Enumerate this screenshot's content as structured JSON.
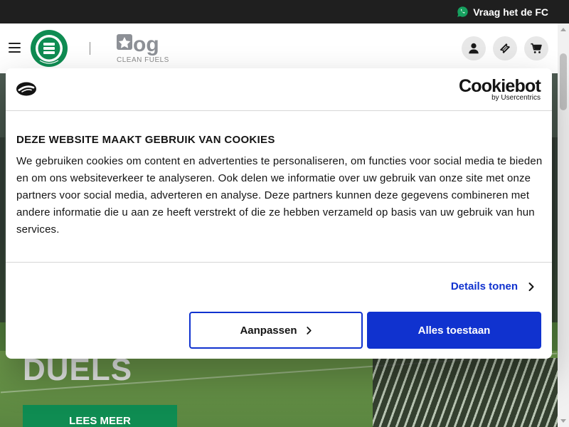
{
  "topbar": {
    "ask_label": "Vraag het de FC",
    "ask_icon": "chat-bubble-icon",
    "accent": "#0f8c52"
  },
  "header": {
    "menu_icon": "hamburger-menu-icon",
    "club_logo_text": "FC GRONINGEN",
    "sponsor_logo_text": "og",
    "sponsor_tagline": "CLEAN FUELS",
    "icons": [
      "user-icon",
      "ticket-icon",
      "cart-icon"
    ]
  },
  "hero": {
    "title": "DUELS",
    "button_label": "LEES MEER"
  },
  "cookie_dialog": {
    "brand_name": "Cookiebot",
    "brand_sub": "by Usercentrics",
    "title": "DEZE WEBSITE MAAKT GEBRUIK VAN COOKIES",
    "text": "We gebruiken cookies om content en advertenties te personaliseren, om functies voor social media te bieden en om ons websiteverkeer te analyseren. Ook delen we informatie over uw gebruik van onze site met onze partners voor social media, adverteren en analyse. Deze partners kunnen deze gegevens combineren met andere informatie die u aan ze heeft verstrekt of die ze hebben verzameld op basis van uw gebruik van hun services.",
    "details_label": "Details tonen",
    "customize_label": "Aanpassen",
    "allow_all_label": "Alles toestaan",
    "button_color": "#1032cf"
  }
}
